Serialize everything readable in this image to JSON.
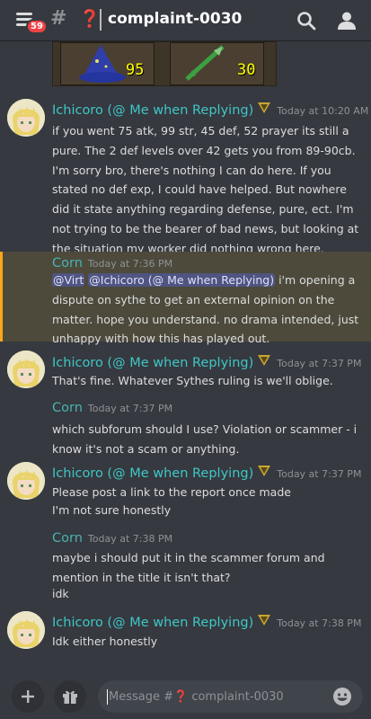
{
  "header": {
    "notification_count": "59",
    "channel_prefix": "#",
    "channel_emoji": "❓",
    "channel_name": "complaint-0030"
  },
  "top_image": {
    "left_value": "95",
    "right_value": "30"
  },
  "messages": [
    {
      "author": "Ichicoro (@ Me when Replying)",
      "timestamp": "Today at 10:20 AM",
      "text": "if you went 75 atk, 99 str, 45 def, 52 prayer its still a pure. The 2 def levels over 42 gets you from 89-90cb. I'm sorry bro, there's nothing I can do here. If you stated no def exp, I could have helped. But nowhere did it state anything regarding defense, pure, ect. I'm not trying to be the bearer of bad news, but looking at the situation my worker did nothing wrong here."
    },
    {
      "author": "Corn",
      "timestamp": "Today at 7:36 PM",
      "mention1": "@Virt",
      "mention2": "@Ichicoro (@ Me when Replying)",
      "text": " i'm opening a dispute on sythe to get an external opinion on the matter. hope you understand. no drama intended, just unhappy with how this has played out."
    },
    {
      "author": "Ichicoro (@ Me when Replying)",
      "timestamp": "Today at 7:37 PM",
      "text": "That's fine. Whatever Sythes ruling is we'll oblige."
    },
    {
      "author": "Corn",
      "timestamp": "Today at 7:37 PM",
      "text": "which subforum should I use? Violation or scammer - i know it's not a scam or anything."
    },
    {
      "author": "Ichicoro (@ Me when Replying)",
      "timestamp": "Today at 7:37 PM",
      "line1": "Please post a link to the report once made",
      "line2": "I'm not sure honestly"
    },
    {
      "author": "Corn",
      "timestamp": "Today at 7:38 PM",
      "line1": "maybe i should put it in the scammer forum and mention in the title it isn't that?",
      "line2": "idk"
    },
    {
      "author": "Ichicoro (@ Me when Replying)",
      "timestamp": "Today at 7:38 PM",
      "text": "Idk either honestly"
    }
  ],
  "composer": {
    "placeholder_prefix": "Message #",
    "placeholder_emoji": "❓",
    "placeholder_channel": " complaint-0030"
  },
  "colors": {
    "background": "#36393f",
    "author_ichicoro": "#3ec7c7",
    "author_corn": "#47b3b3",
    "mention_bg": "#4f5580",
    "highlight_bg": "#4d4a3c",
    "highlight_bar": "#faa61a",
    "badge": "#ed4245"
  }
}
